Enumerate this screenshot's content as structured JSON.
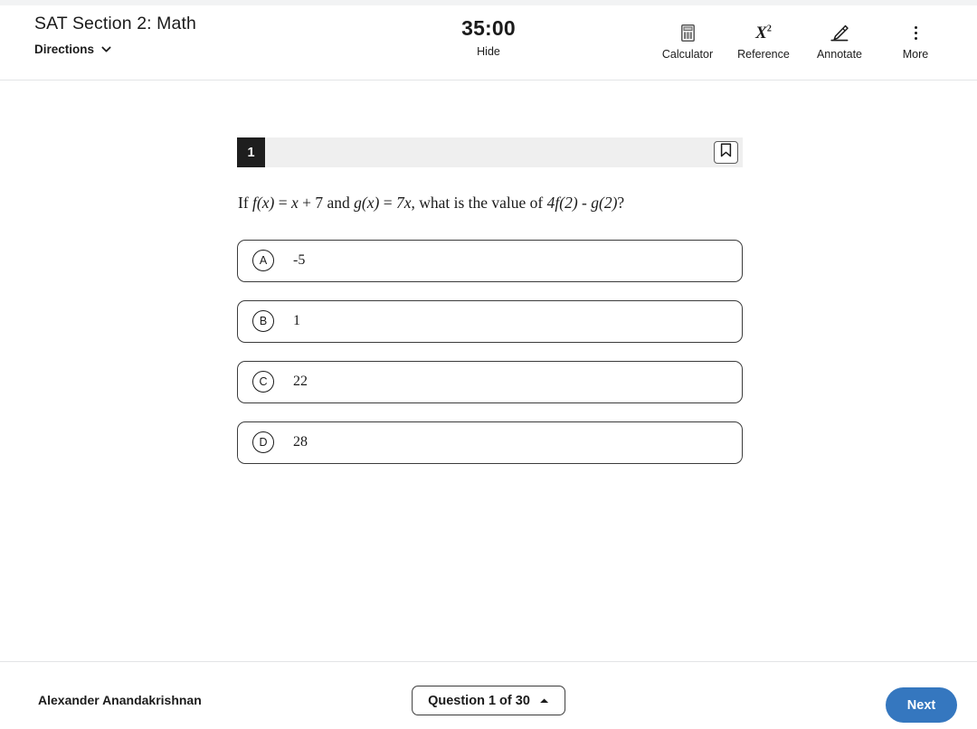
{
  "header": {
    "section_title": "SAT Section 2: Math",
    "directions_label": "Directions",
    "directions_icon": "chevron-down-icon",
    "timer": {
      "value": "35:00",
      "hide_label": "Hide"
    },
    "tools": [
      {
        "label": "Calculator",
        "icon": "calculator-icon"
      },
      {
        "label": "Reference",
        "icon": "x-squared-icon"
      },
      {
        "label": "Annotate",
        "icon": "pencil-highlight-icon"
      },
      {
        "label": "More",
        "icon": "more-vertical-icon"
      }
    ]
  },
  "question": {
    "number": "1",
    "bookmark_icon": "bookmark-icon",
    "prompt_parts": {
      "p1": "If ",
      "m1": "f(x)",
      "p2": " = ",
      "m2": "x",
      "p3": " + 7 and ",
      "m3": "g(x)",
      "p4": " = ",
      "m4": "7x",
      "p5": ", what is the value of ",
      "m5": "4f(2) - g(2)",
      "p6": "?"
    },
    "choices": [
      {
        "letter": "A",
        "text": "-5"
      },
      {
        "letter": "B",
        "text": "1"
      },
      {
        "letter": "C",
        "text": "22"
      },
      {
        "letter": "D",
        "text": "28"
      }
    ]
  },
  "footer": {
    "student_name": "Alexander Anandakrishnan",
    "question_nav_label": "Question 1 of 30",
    "question_nav_icon": "chevron-up-icon",
    "next_label": "Next"
  },
  "colors": {
    "accent_blue": "#3577bf",
    "badge_dark": "#1e1e1e",
    "bar_gray": "#efefef"
  }
}
